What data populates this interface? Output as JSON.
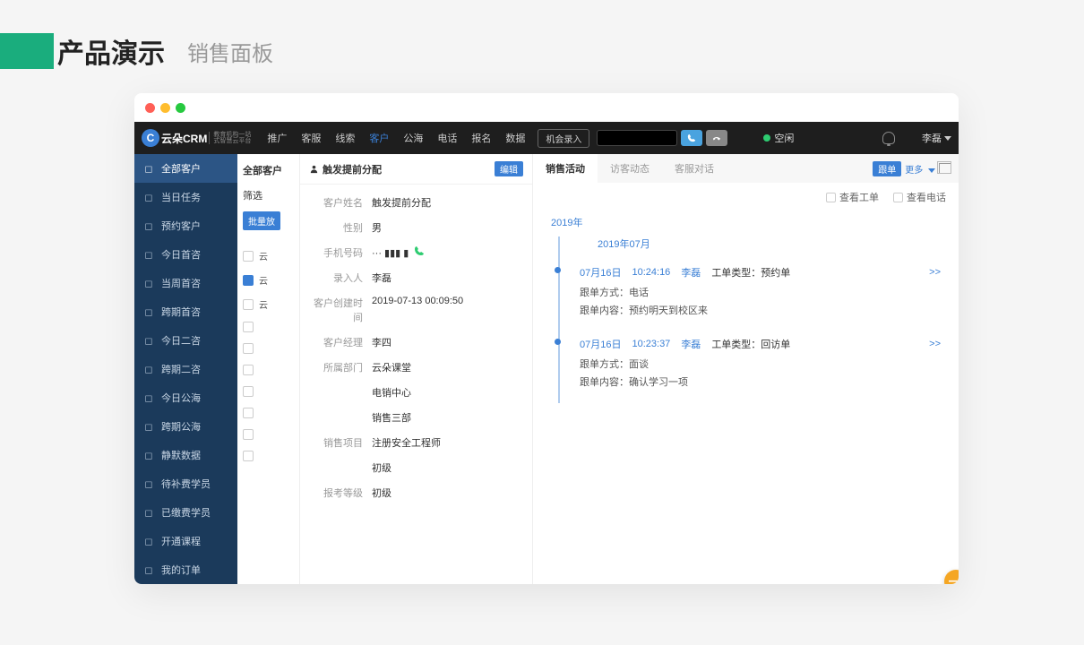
{
  "page": {
    "title_main": "产品演示",
    "title_sub": "销售面板"
  },
  "topnav": {
    "logo_text": "云朵CRM",
    "logo_sub1": "教育机构一站",
    "logo_sub2": "式智慧云平台",
    "items": [
      "推广",
      "客服",
      "线索",
      "客户",
      "公海",
      "电话",
      "报名",
      "数据"
    ],
    "active_index": 3,
    "opportunity_btn": "机会录入",
    "status_text": "空闲",
    "user_name": "李磊"
  },
  "sidebar": {
    "items": [
      {
        "label": "全部客户",
        "icon": "user-icon"
      },
      {
        "label": "当日任务",
        "icon": "check-icon"
      },
      {
        "label": "预约客户",
        "icon": "person-icon"
      },
      {
        "label": "今日首咨",
        "icon": "chat-icon"
      },
      {
        "label": "当周首咨",
        "icon": "chat-icon"
      },
      {
        "label": "跨期首咨",
        "icon": "chat-icon"
      },
      {
        "label": "今日二咨",
        "icon": "chat-icon"
      },
      {
        "label": "跨期二咨",
        "icon": "chat-icon"
      },
      {
        "label": "今日公海",
        "icon": "sea-icon"
      },
      {
        "label": "跨期公海",
        "icon": "sea-icon"
      },
      {
        "label": "静默数据",
        "icon": "mute-icon"
      },
      {
        "label": "待补费学员",
        "icon": "fee-icon"
      },
      {
        "label": "已缴费学员",
        "icon": "paid-icon"
      },
      {
        "label": "开通课程",
        "icon": "course-icon"
      },
      {
        "label": "我的订单",
        "icon": "order-icon"
      }
    ],
    "active_index": 0
  },
  "list": {
    "title": "全部客户",
    "filter_label": "筛选",
    "batch_btn": "批量放",
    "rows": [
      "云",
      "云",
      "云",
      "",
      "",
      "",
      "",
      "",
      "",
      ""
    ]
  },
  "detail": {
    "header_title": "触发提前分配",
    "edit_btn": "编辑",
    "fields": [
      {
        "label": "客户姓名",
        "value": "触发提前分配"
      },
      {
        "label": "性别",
        "value": "男"
      },
      {
        "label": "手机号码",
        "value": "··· ▮▮▮ ▮",
        "phone": true
      },
      {
        "label": "录入人",
        "value": "李磊"
      },
      {
        "label": "客户创建时间",
        "value": "2019-07-13 00:09:50"
      },
      {
        "label": "客户经理",
        "value": "李四"
      },
      {
        "label": "所属部门",
        "value": "云朵课堂"
      },
      {
        "label": "",
        "value": "电销中心"
      },
      {
        "label": "",
        "value": "销售三部"
      },
      {
        "label": "销售项目",
        "value": "注册安全工程师"
      },
      {
        "label": "",
        "value": "初级"
      },
      {
        "label": "报考等级",
        "value": "初级"
      }
    ]
  },
  "activity": {
    "tabs": [
      "销售活动",
      "访客动态",
      "客服对话"
    ],
    "active_tab": 0,
    "follow_btn": "跟单",
    "more_text": "更多",
    "filters": [
      "查看工单",
      "查看电话"
    ],
    "timeline": {
      "year_label": "2019年",
      "month_label": "2019年07月",
      "entries": [
        {
          "date": "07月16日",
          "time": "10:24:16",
          "user": "李磊",
          "type_label": "工单类型：",
          "type_value": "预约单",
          "method_label": "跟单方式：",
          "method_value": "电话",
          "content_label": "跟单内容：",
          "content_value": "预约明天到校区来",
          "expand": ">>"
        },
        {
          "date": "07月16日",
          "time": "10:23:37",
          "user": "李磊",
          "type_label": "工单类型：",
          "type_value": "回访单",
          "method_label": "跟单方式：",
          "method_value": "面谈",
          "content_label": "跟单内容：",
          "content_value": "确认学习一项",
          "expand": ">>"
        }
      ]
    }
  },
  "fab": "—"
}
